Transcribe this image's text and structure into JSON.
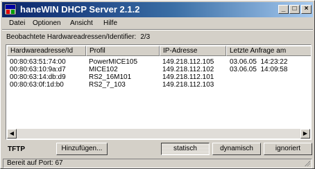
{
  "window": {
    "title": "haneWIN DHCP Server 2.1.2"
  },
  "menu": [
    {
      "label": "Datei"
    },
    {
      "label": "Optionen"
    },
    {
      "label": "Ansicht"
    },
    {
      "label": "Hilfe"
    }
  ],
  "observed": {
    "label": "Beobachtete Hardwareadressen/Identifier:",
    "count": "2/3"
  },
  "table": {
    "columns": [
      "Hardwareadresse/Id",
      "Profil",
      "IP-Adresse",
      "Letzte Anfrage am"
    ],
    "rows": [
      [
        "00:80:63:51:74:00",
        "PowerMICE105",
        "149.218.112.105",
        "03.06.05  14:23:22"
      ],
      [
        "00:80:63:10:9a:d7",
        "MICE102",
        "149.218.112.102",
        "03.06.05  14:09:58"
      ],
      [
        "00:80:63:14:db:d9",
        "RS2_16M101",
        "149.218.112.101",
        ""
      ],
      [
        "00:80:63:0f:1d:b0",
        "RS2_7_103",
        "149.218.112.103",
        ""
      ]
    ]
  },
  "footer": {
    "tftp_label": "TFTP",
    "add_button": "Hinzufügen...",
    "static_button": "statisch",
    "dynamic_button": "dynamisch",
    "ignored_button": "ignoriert"
  },
  "status": "Bereit auf Port: 67",
  "colors": {
    "titlebar_start": "#0a246a",
    "titlebar_end": "#a6caf0",
    "face": "#d4d0c8"
  }
}
